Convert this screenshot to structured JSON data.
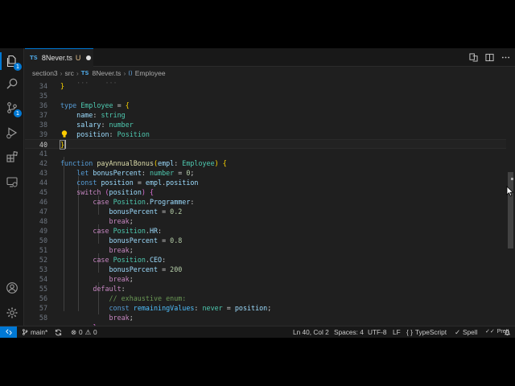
{
  "tab": {
    "icon": "TS",
    "filename": "8Never.ts",
    "status": "U"
  },
  "breadcrumb": {
    "folder1": "section3",
    "folder2": "src",
    "file_icon": "TS",
    "file": "8Never.ts",
    "symbol": "Employee"
  },
  "code_lines": [
    {
      "n": "34"
    },
    {
      "n": "35"
    },
    {
      "n": "36"
    },
    {
      "n": "37"
    },
    {
      "n": "38"
    },
    {
      "n": "39"
    },
    {
      "n": "40"
    },
    {
      "n": "41"
    },
    {
      "n": "42"
    },
    {
      "n": "43"
    },
    {
      "n": "44"
    },
    {
      "n": "45"
    },
    {
      "n": "46"
    },
    {
      "n": "47"
    },
    {
      "n": "48"
    },
    {
      "n": "49"
    },
    {
      "n": "50"
    },
    {
      "n": "51"
    },
    {
      "n": "52"
    },
    {
      "n": "53"
    },
    {
      "n": "54"
    },
    {
      "n": "55"
    },
    {
      "n": "56"
    },
    {
      "n": "57"
    },
    {
      "n": "58"
    }
  ],
  "status": {
    "branch": "main*",
    "errors": "0",
    "warnings": "0",
    "position": "Ln 40, Col 2",
    "spaces": "Spaces: 4",
    "encoding": "UTF-8",
    "eol": "LF",
    "language": "TypeScript",
    "spell": "Spell",
    "prettier": "Prettier"
  },
  "icons": [
    "explorer-icon",
    "search-icon",
    "source-control-icon",
    "run-debug-icon",
    "extensions-icon",
    "remote-explorer-icon",
    "account-icon",
    "settings-gear-icon"
  ],
  "colors": {
    "accent": "#0078d4",
    "background": "#1f1f1f",
    "keyword": "#569cd6",
    "type": "#4ec9b0",
    "function": "#dcdcaa",
    "comment": "#6a9955",
    "number": "#b5cea8"
  }
}
